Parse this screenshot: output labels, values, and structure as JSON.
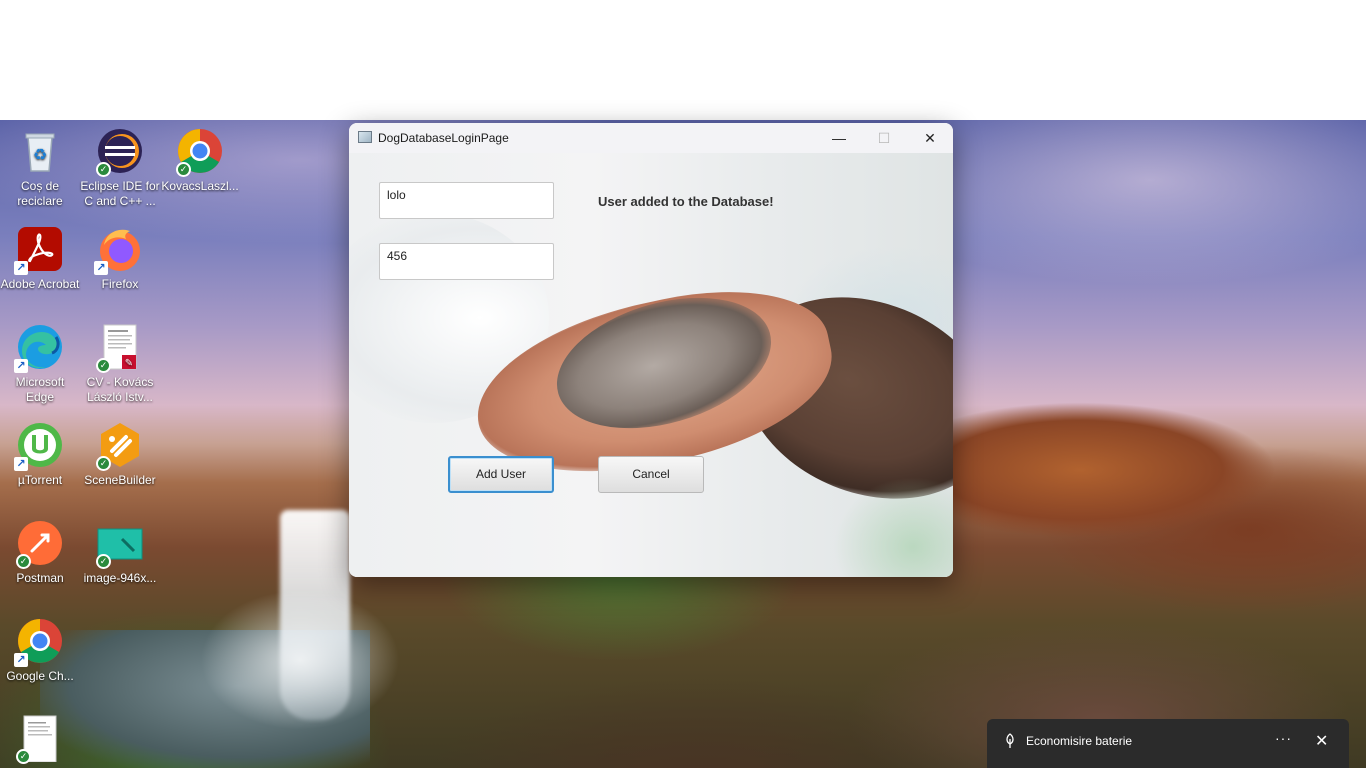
{
  "desktop": {
    "icons": [
      {
        "label": "Coș de reciclare",
        "icon": "recycle-bin-icon"
      },
      {
        "label": "Eclipse IDE for C and C++ ...",
        "icon": "eclipse-icon"
      },
      {
        "label": "KovacsLaszl...",
        "icon": "chrome-icon"
      },
      {
        "label": "Adobe Acrobat",
        "icon": "acrobat-icon"
      },
      {
        "label": "Firefox",
        "icon": "firefox-icon"
      },
      {
        "label": "Microsoft Edge",
        "icon": "edge-icon"
      },
      {
        "label": "CV - Kovács László Istv...",
        "icon": "pdf-document-icon"
      },
      {
        "label": "µTorrent",
        "icon": "utorrent-icon"
      },
      {
        "label": "SceneBuilder",
        "icon": "scenebuilder-icon"
      },
      {
        "label": "Postman",
        "icon": "postman-icon"
      },
      {
        "label": "image-946x...",
        "icon": "image-file-icon"
      },
      {
        "label": "Google Ch...",
        "icon": "chrome-icon"
      },
      {
        "label": "",
        "icon": "document-icon"
      }
    ]
  },
  "window": {
    "title": "DogDatabaseLoginPage",
    "controls": {
      "minimize": "—",
      "maximize": "☐",
      "close": "✕"
    },
    "username_value": "lolo",
    "password_value": "456",
    "status_message": "User added to the Database!",
    "add_button_label": "Add User",
    "cancel_button_label": "Cancel"
  },
  "notification": {
    "text": "Economisire baterie",
    "icon": "battery-saver-icon",
    "more": "···",
    "close": "✕"
  },
  "colors": {
    "focus_ring": "#3a8fcf",
    "toast_bg": "#2b2b2b"
  }
}
